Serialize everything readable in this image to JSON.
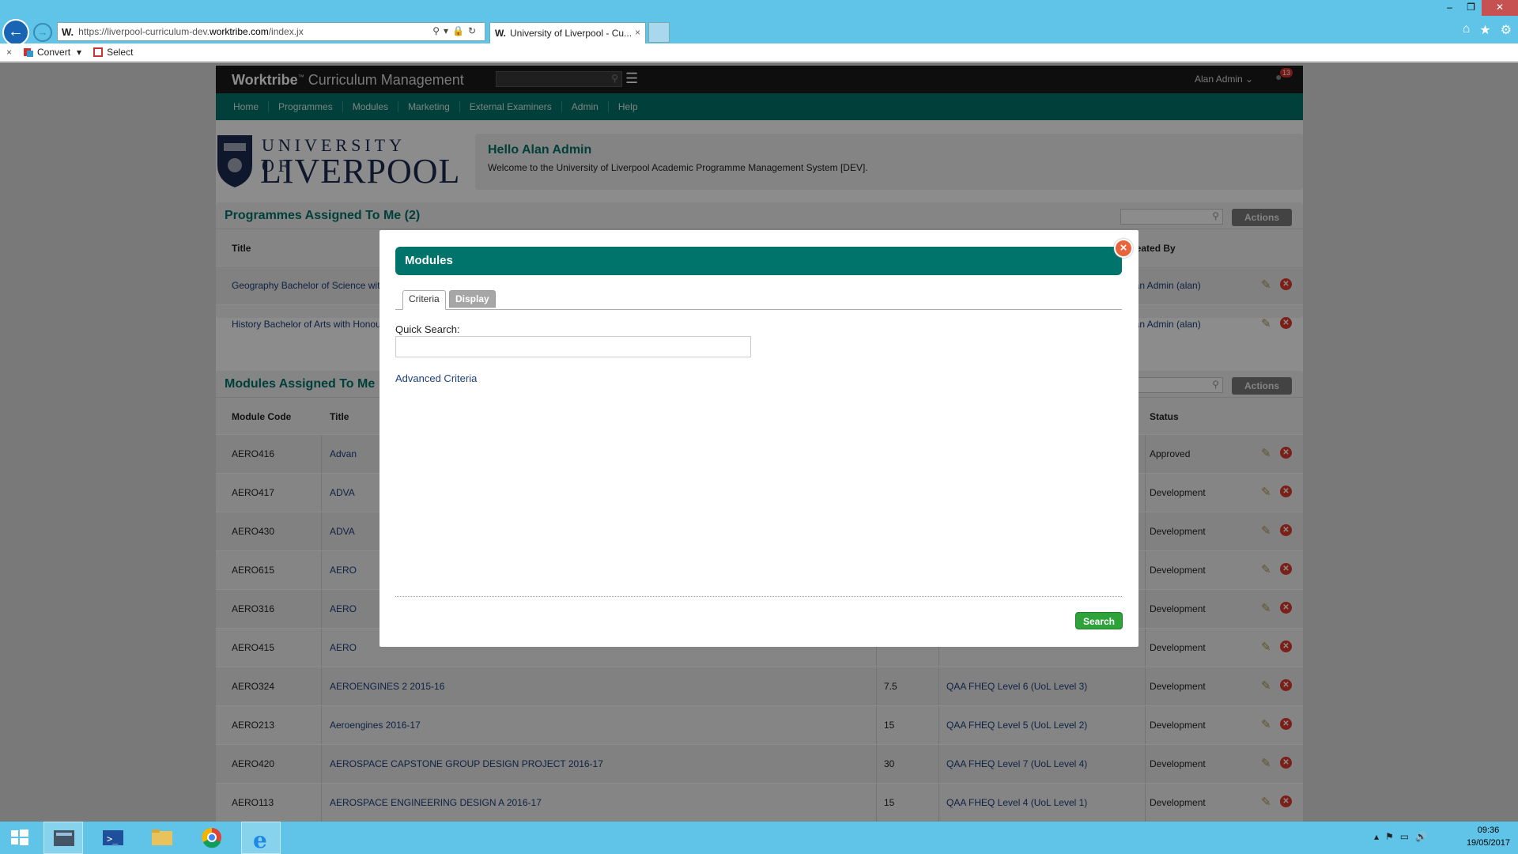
{
  "browser": {
    "url_prefix": "https://liverpool-curriculum-dev.",
    "url_host": "worktribe.com",
    "url_suffix": "/index.jx",
    "favicon": "W.",
    "tab_title": "University of Liverpool - Cu...",
    "tab_close": "×",
    "window_controls": [
      "–",
      "❐",
      "✕"
    ],
    "tools": [
      "⌂",
      "★",
      "⚙"
    ],
    "commands": {
      "close": "×",
      "convert": "Convert",
      "select": "Select"
    }
  },
  "app": {
    "brand": "Worktribe",
    "brand_mark": "™",
    "product": " Curriculum Management",
    "user": "Alan Admin",
    "user_caret": "⌄",
    "notification_count": "13",
    "nav": [
      "Home",
      "Programmes",
      "Modules",
      "Marketing",
      "External Examiners",
      "Admin",
      "Help"
    ]
  },
  "logo": {
    "line1": "UNIVERSITY OF",
    "line2": "LIVERPOOL"
  },
  "hello": {
    "title": "Hello Alan Admin",
    "text": "Welcome to the University of Liverpool Academic Programme Management System [DEV]."
  },
  "programmes": {
    "title": "Programmes Assigned To Me (2)",
    "actions": "Actions",
    "col_title": "Title",
    "col_created": "reated By",
    "rows": [
      {
        "title": "Geography Bachelor of Science wit",
        "created": "lan Admin (alan)"
      },
      {
        "title": "History Bachelor of Arts with Honou",
        "created": "lan Admin (alan)"
      }
    ]
  },
  "modules": {
    "title": "Modules Assigned To Me",
    "actions": "Actions",
    "col_code": "Module Code",
    "col_title": "Title",
    "col_status": "Status",
    "rows": [
      {
        "code": "AERO416",
        "title": "Advan",
        "credits": "",
        "level": "",
        "status": "Approved"
      },
      {
        "code": "AERO417",
        "title": "ADVA",
        "credits": "",
        "level": "",
        "status": "Development"
      },
      {
        "code": "AERO430",
        "title": "ADVA",
        "credits": "",
        "level": "",
        "status": "Development"
      },
      {
        "code": "AERO615",
        "title": "AERO",
        "credits": "",
        "level": "",
        "status": "Development"
      },
      {
        "code": "AERO316",
        "title": "AERO",
        "credits": "",
        "level": "",
        "status": "Development"
      },
      {
        "code": "AERO415",
        "title": "AERO",
        "credits": "",
        "level": "",
        "status": "Development"
      },
      {
        "code": "AERO324",
        "title": "AEROENGINES 2 2015-16",
        "credits": "7.5",
        "level": "QAA FHEQ Level 6 (UoL Level 3)",
        "status": "Development"
      },
      {
        "code": "AERO213",
        "title": "Aeroengines 2016-17",
        "credits": "15",
        "level": "QAA FHEQ Level 5 (UoL Level 2)",
        "status": "Development"
      },
      {
        "code": "AERO420",
        "title": "AEROSPACE CAPSTONE GROUP DESIGN PROJECT 2016-17",
        "credits": "30",
        "level": "QAA FHEQ Level 7 (UoL Level 4)",
        "status": "Development"
      },
      {
        "code": "AERO113",
        "title": "AEROSPACE ENGINEERING DESIGN A 2016-17",
        "credits": "15",
        "level": "QAA FHEQ Level 4 (UoL Level 1)",
        "status": "Development"
      }
    ]
  },
  "modal": {
    "title": "Modules",
    "close": "×",
    "tabs": [
      "Criteria",
      "Display"
    ],
    "quick_search_label": "Quick Search:",
    "quick_search_value": "",
    "advanced": "Advanced Criteria",
    "search": "Search"
  },
  "taskbar": {
    "time": "09:36",
    "date": "19/05/2017"
  },
  "icons": {
    "row_edit": "✎",
    "row_delete": "✕",
    "search": "⚲",
    "menu": "☰",
    "bell": "●"
  }
}
